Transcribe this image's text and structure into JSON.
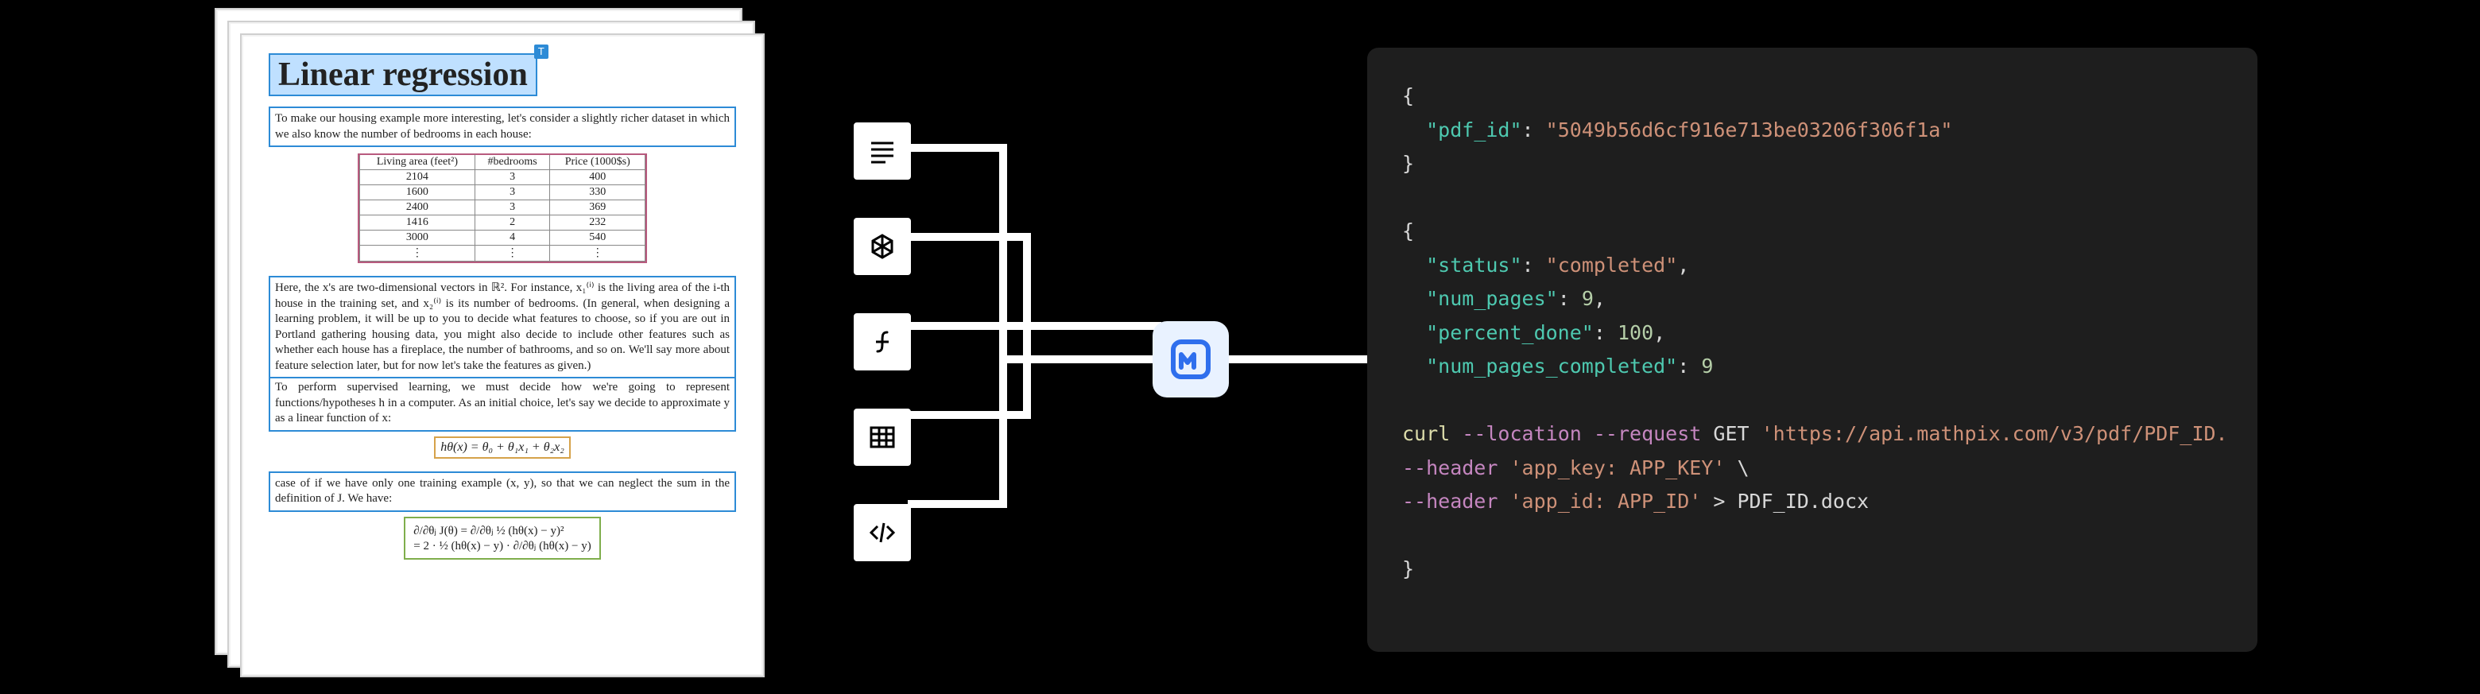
{
  "document": {
    "title": "Linear regression",
    "badge": "T",
    "para1": "To make our housing example more interesting, let's consider a slightly richer dataset in which we also know the number of bedrooms in each house:",
    "table": {
      "headers": [
        "Living area (feet²)",
        "#bedrooms",
        "Price (1000$s)"
      ],
      "rows": [
        [
          "2104",
          "3",
          "400"
        ],
        [
          "1600",
          "3",
          "330"
        ],
        [
          "2400",
          "3",
          "369"
        ],
        [
          "1416",
          "2",
          "232"
        ],
        [
          "3000",
          "4",
          "540"
        ],
        [
          "⋮",
          "⋮",
          "⋮"
        ]
      ]
    },
    "para2": "Here, the x's are two-dimensional vectors in ℝ². For instance, x₁⁽ⁱ⁾ is the living area of the i-th house in the training set, and x₂⁽ⁱ⁾ is its number of bedrooms. (In general, when designing a learning problem, it will be up to you to decide what features to choose, so if you are out in Portland gathering housing data, you might also decide to include other features such as whether each house has a fireplace, the number of bathrooms, and so on. We'll say more about feature selection later, but for now let's take the features as given.)",
    "para3": "To perform supervised learning, we must decide how we're going to represent functions/hypotheses h in a computer. As an initial choice, let's say we decide to approximate y as a linear function of x:",
    "equation1": "hθ(x) = θ₀ + θ₁x₁ + θ₂x₂",
    "para4": "case of if we have only one training example (x, y), so that we can neglect the sum in the definition of J. We have:",
    "equation2_l1": "∂/∂θⱼ J(θ)   =   ∂/∂θⱼ ½ (hθ(x) − y)²",
    "equation2_l2": "            =   2 · ½ (hθ(x) − y) · ∂/∂θⱼ (hθ(x) − y)"
  },
  "extract_icons": {
    "text": "text-lines-icon",
    "chem": "molecule-icon",
    "math": "function-icon",
    "table": "table-icon",
    "code": "code-icon"
  },
  "logo": "mathpix-logo",
  "api": {
    "obj1": {
      "key1": "pdf_id",
      "val1": "5049b56d6cf916e713be03206f306f1a"
    },
    "obj2": {
      "k_status": "status",
      "v_status": "completed",
      "k_np": "num_pages",
      "v_np": 9,
      "k_pd": "percent_done",
      "v_pd": 100,
      "k_npc": "num_pages_completed",
      "v_npc": 9
    },
    "curl": {
      "cmd": "curl",
      "flag_loc": "--location",
      "flag_req": "--request",
      "method": "GET",
      "url": "'https://api.mathpix.com/v3/pdf/PDF_ID.",
      "flag_h1": "--header",
      "h1": "'app_key: APP_KEY'",
      "bs": "\\",
      "flag_h2": "--header",
      "h2": "'app_id: APP_ID'",
      "redir": ">",
      "out": "PDF_ID.docx"
    }
  }
}
